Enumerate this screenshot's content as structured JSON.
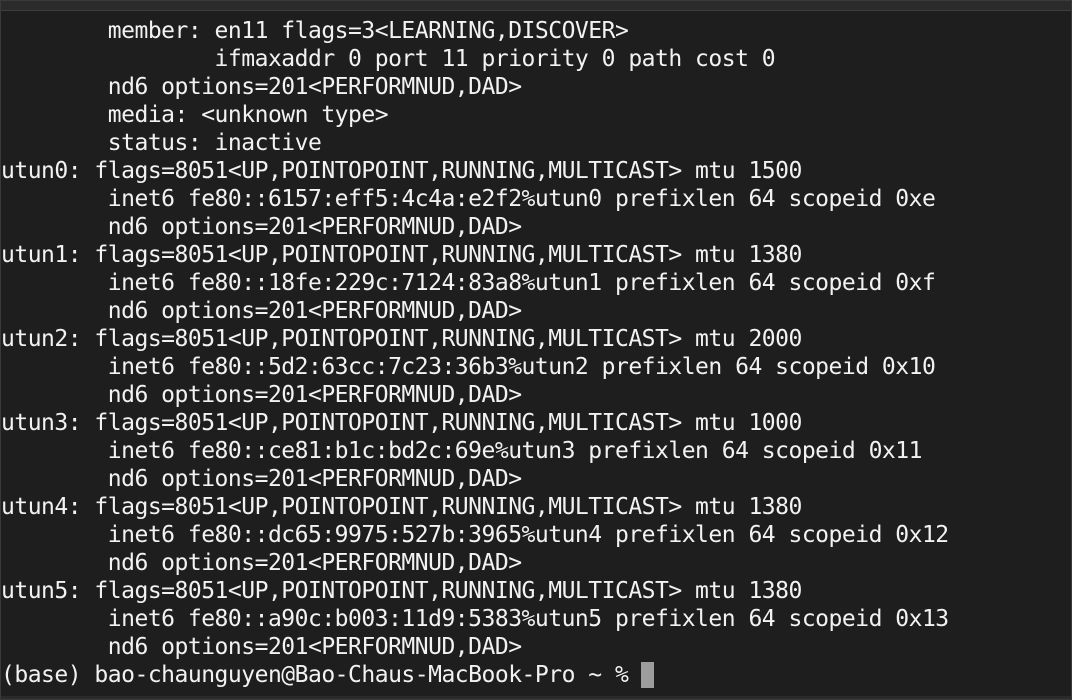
{
  "terminal": {
    "lines": [
      "        member: en11 flags=3<LEARNING,DISCOVER>",
      "                ifmaxaddr 0 port 11 priority 0 path cost 0",
      "        nd6 options=201<PERFORMNUD,DAD>",
      "        media: <unknown type>",
      "        status: inactive",
      "utun0: flags=8051<UP,POINTOPOINT,RUNNING,MULTICAST> mtu 1500",
      "        inet6 fe80::6157:eff5:4c4a:e2f2%utun0 prefixlen 64 scopeid 0xe",
      "        nd6 options=201<PERFORMNUD,DAD>",
      "utun1: flags=8051<UP,POINTOPOINT,RUNNING,MULTICAST> mtu 1380",
      "        inet6 fe80::18fe:229c:7124:83a8%utun1 prefixlen 64 scopeid 0xf",
      "        nd6 options=201<PERFORMNUD,DAD>",
      "utun2: flags=8051<UP,POINTOPOINT,RUNNING,MULTICAST> mtu 2000",
      "        inet6 fe80::5d2:63cc:7c23:36b3%utun2 prefixlen 64 scopeid 0x10",
      "        nd6 options=201<PERFORMNUD,DAD>",
      "utun3: flags=8051<UP,POINTOPOINT,RUNNING,MULTICAST> mtu 1000",
      "        inet6 fe80::ce81:b1c:bd2c:69e%utun3 prefixlen 64 scopeid 0x11",
      "        nd6 options=201<PERFORMNUD,DAD>",
      "utun4: flags=8051<UP,POINTOPOINT,RUNNING,MULTICAST> mtu 1380",
      "        inet6 fe80::dc65:9975:527b:3965%utun4 prefixlen 64 scopeid 0x12",
      "        nd6 options=201<PERFORMNUD,DAD>",
      "utun5: flags=8051<UP,POINTOPOINT,RUNNING,MULTICAST> mtu 1380",
      "        inet6 fe80::a90c:b003:11d9:5383%utun5 prefixlen 64 scopeid 0x13",
      "        nd6 options=201<PERFORMNUD,DAD>"
    ],
    "prompt": "(base) bao-chaunguyen@Bao-Chaus-MacBook-Pro ~ %",
    "colors": {
      "background": "#1e1e1e",
      "text": "#f2f2f2",
      "cursor": "#9d9d9d"
    }
  }
}
